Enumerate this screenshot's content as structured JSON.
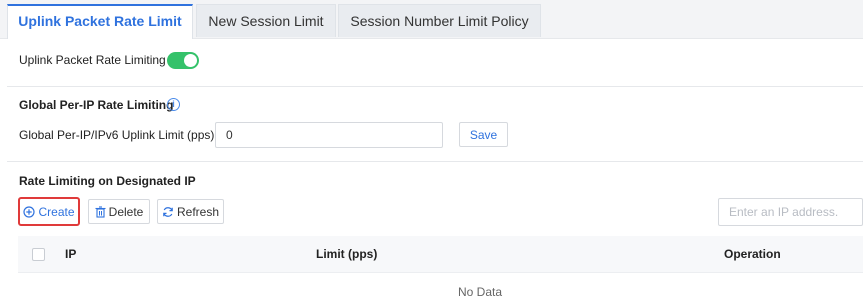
{
  "tabs": [
    {
      "label": "Uplink Packet Rate Limit",
      "active": true
    },
    {
      "label": "New Session Limit",
      "active": false
    },
    {
      "label": "Session Number Limit Policy",
      "active": false
    }
  ],
  "uplink": {
    "toggle_label": "Uplink Packet Rate Limiting",
    "enabled": true
  },
  "global": {
    "section_title": "Global Per-IP Rate Limiting",
    "info_icon": "info-icon",
    "field_label": "Global Per-IP/IPv6 Uplink Limit (pps)",
    "field_value": "0",
    "save_label": "Save"
  },
  "designated": {
    "section_title": "Rate Limiting on Designated IP",
    "create_label": "Create",
    "delete_label": "Delete",
    "refresh_label": "Refresh",
    "search_placeholder": "Enter an IP address."
  },
  "table": {
    "columns": [
      "IP",
      "Limit (pps)",
      "Operation"
    ],
    "empty_text": "No Data"
  },
  "colors": {
    "accent": "#2f72de",
    "toggle_on": "#34c26a",
    "highlight": "#e03a3a"
  }
}
